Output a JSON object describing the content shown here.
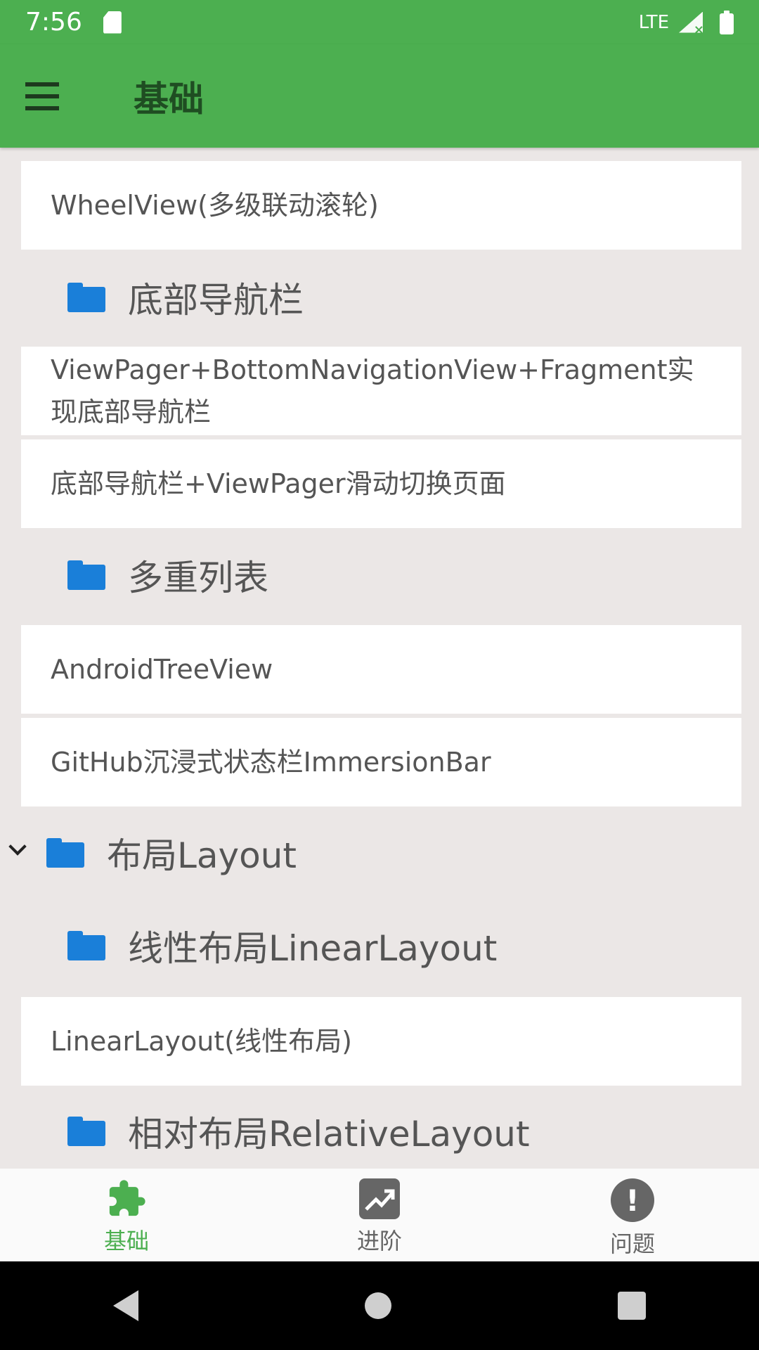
{
  "status_bar": {
    "time": "7:56",
    "network": "LTE"
  },
  "app_bar": {
    "title": "基础"
  },
  "list": {
    "items": [
      {
        "kind": "card",
        "text": "WheelView(多级联动滚轮)"
      },
      {
        "kind": "folder",
        "text": "底部导航栏"
      },
      {
        "kind": "card",
        "text": "ViewPager+BottomNavigationView+Fragment实现底部导航栏"
      },
      {
        "kind": "card",
        "text": "底部导航栏+ViewPager滑动切换页面"
      },
      {
        "kind": "folder",
        "text": "多重列表"
      },
      {
        "kind": "card",
        "text": "AndroidTreeView"
      },
      {
        "kind": "card",
        "text": "GitHub沉浸式状态栏ImmersionBar"
      },
      {
        "kind": "folder-expanded",
        "text": "布局Layout"
      },
      {
        "kind": "folder",
        "text": "线性布局LinearLayout"
      },
      {
        "kind": "card",
        "text": "LinearLayout(线性布局)"
      },
      {
        "kind": "folder",
        "text": "相对布局RelativeLayout"
      }
    ]
  },
  "bottom_nav": {
    "items": [
      {
        "label": "基础",
        "icon": "puzzle-icon",
        "active": true
      },
      {
        "label": "进阶",
        "icon": "trending-up-icon",
        "active": false
      },
      {
        "label": "问题",
        "icon": "alert-icon",
        "active": false
      }
    ]
  },
  "colors": {
    "primary": "#4caf50",
    "background": "#ebe7e6",
    "folder": "#1a7fd9"
  }
}
